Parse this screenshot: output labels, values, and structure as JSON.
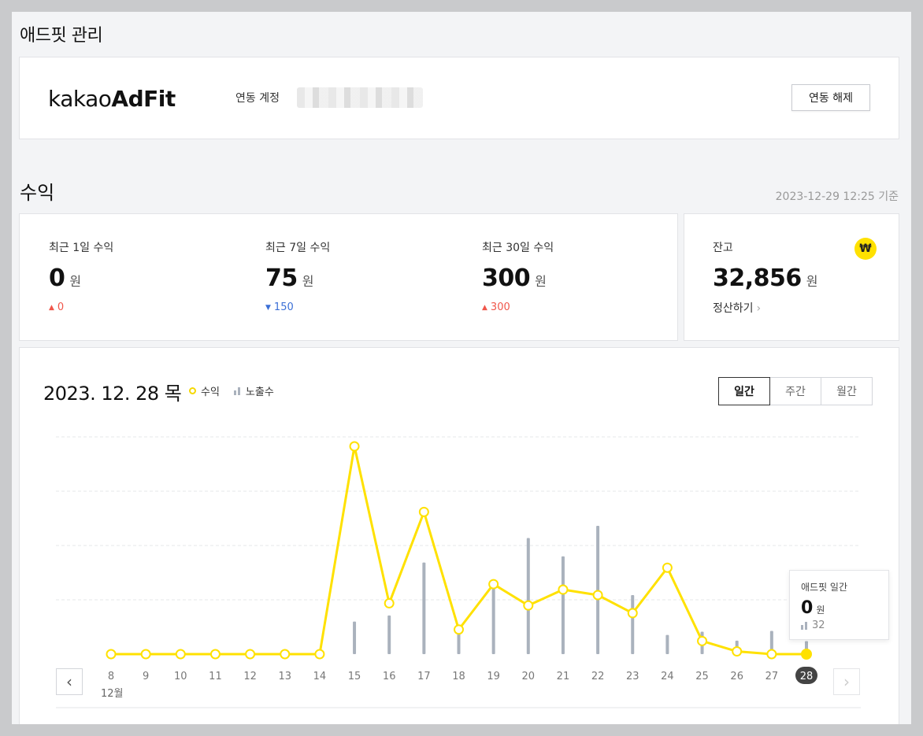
{
  "page": {
    "title": "애드핏 관리"
  },
  "account": {
    "logo_light": "kakao",
    "logo_bold": "AdFit",
    "linked_label": "연동 계정",
    "unlink_button": "연동 해제"
  },
  "revenue": {
    "section_title": "수익",
    "timestamp": "2023-12-29 12:25 기준",
    "items": [
      {
        "label": "최근 1일 수익",
        "value": "0",
        "unit": "원",
        "delta": "0",
        "direction": "up"
      },
      {
        "label": "최근 7일 수익",
        "value": "75",
        "unit": "원",
        "delta": "150",
        "direction": "down"
      },
      {
        "label": "최근 30일 수익",
        "value": "300",
        "unit": "원",
        "delta": "300",
        "direction": "up"
      }
    ],
    "balance": {
      "label": "잔고",
      "value": "32,856",
      "unit": "원",
      "settle_link": "정산하기",
      "badge_icon": "won-icon",
      "badge_symbol": "₩"
    }
  },
  "chart": {
    "date_title": "2023. 12. 28 목",
    "legend": {
      "revenue": "수익",
      "impressions": "노출수"
    },
    "period_tabs": [
      {
        "label": "일간",
        "active": true
      },
      {
        "label": "주간",
        "active": false
      },
      {
        "label": "월간",
        "active": false
      }
    ],
    "month_label": "12월",
    "tooltip": {
      "title": "애드핏 일간",
      "value": "0",
      "unit": "원",
      "impressions": "32"
    },
    "colors": {
      "revenue": "#ffe100",
      "impressions": "#aab2bd",
      "selected_day": "#444444"
    }
  },
  "chart_data": {
    "type": "line",
    "x": [
      "8",
      "9",
      "10",
      "11",
      "12",
      "13",
      "14",
      "15",
      "16",
      "17",
      "18",
      "19",
      "20",
      "21",
      "22",
      "23",
      "24",
      "25",
      "26",
      "27",
      "28"
    ],
    "series": [
      {
        "name": "수익",
        "type": "line",
        "values": [
          0,
          0,
          0,
          0,
          0,
          0,
          0,
          38,
          9.3,
          26,
          4.5,
          12.8,
          8.9,
          11.8,
          10.8,
          7.5,
          15.8,
          2.4,
          0.5,
          0,
          0
        ]
      },
      {
        "name": "노출수",
        "type": "bar",
        "values": [
          0,
          0,
          0,
          0,
          0,
          0,
          0,
          80,
          95,
          225,
          50,
          165,
          285,
          240,
          315,
          145,
          47,
          55,
          33,
          57,
          32
        ]
      }
    ],
    "selected_x": "28",
    "grid": true
  }
}
